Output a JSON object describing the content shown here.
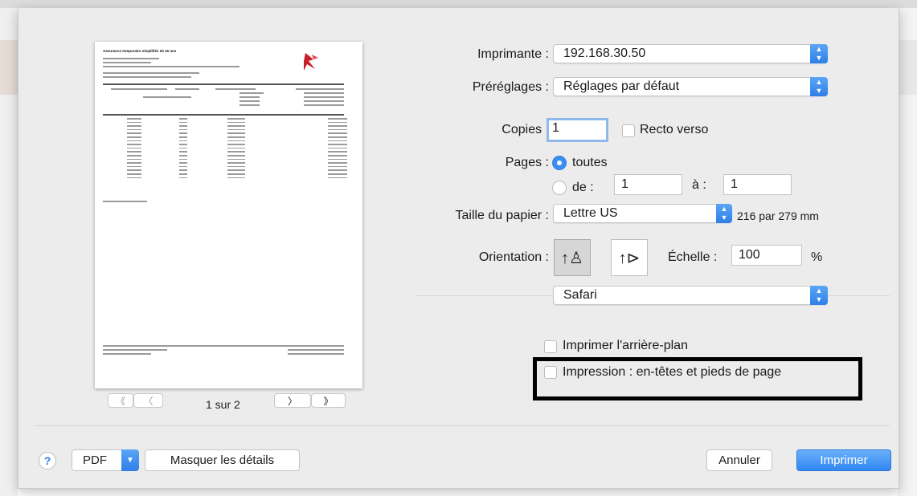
{
  "printer": {
    "label": "Imprimante :",
    "value": "192.168.30.50"
  },
  "presets": {
    "label": "Préréglages :",
    "value": "Réglages par défaut"
  },
  "copies": {
    "label": "Copies :",
    "value": "1",
    "duplex_label": "Recto verso"
  },
  "pages": {
    "label": "Pages :",
    "all_label": "toutes",
    "from_label": "de :",
    "from_value": "1",
    "to_label": "à :",
    "to_value": "1"
  },
  "paper": {
    "label": "Taille du papier :",
    "value": "Lettre US",
    "dims": "216 par 279 mm"
  },
  "orientation": {
    "label": "Orientation :",
    "scale_label": "Échelle :",
    "scale_value": "100",
    "scale_unit": "%"
  },
  "app_menu": {
    "value": "Safari"
  },
  "safari_options": {
    "print_backgrounds": "Imprimer l'arrière-plan",
    "print_headers": "Impression : en-têtes et pieds de page"
  },
  "preview_nav": {
    "first": "《",
    "prev": "〈",
    "next": "〉",
    "last": "》",
    "page_label": "1 sur 2"
  },
  "preview_doc": {
    "title": "Assurance temporaire simplifiée de 20 ans",
    "logo": "Plateforme Financière Concordia"
  },
  "bottom": {
    "help": "?",
    "pdf": "PDF",
    "hide_details": "Masquer les détails",
    "cancel": "Annuler",
    "print": "Imprimer"
  },
  "colors": {
    "accent": "#3086f0",
    "highlight_box": "#000000"
  }
}
